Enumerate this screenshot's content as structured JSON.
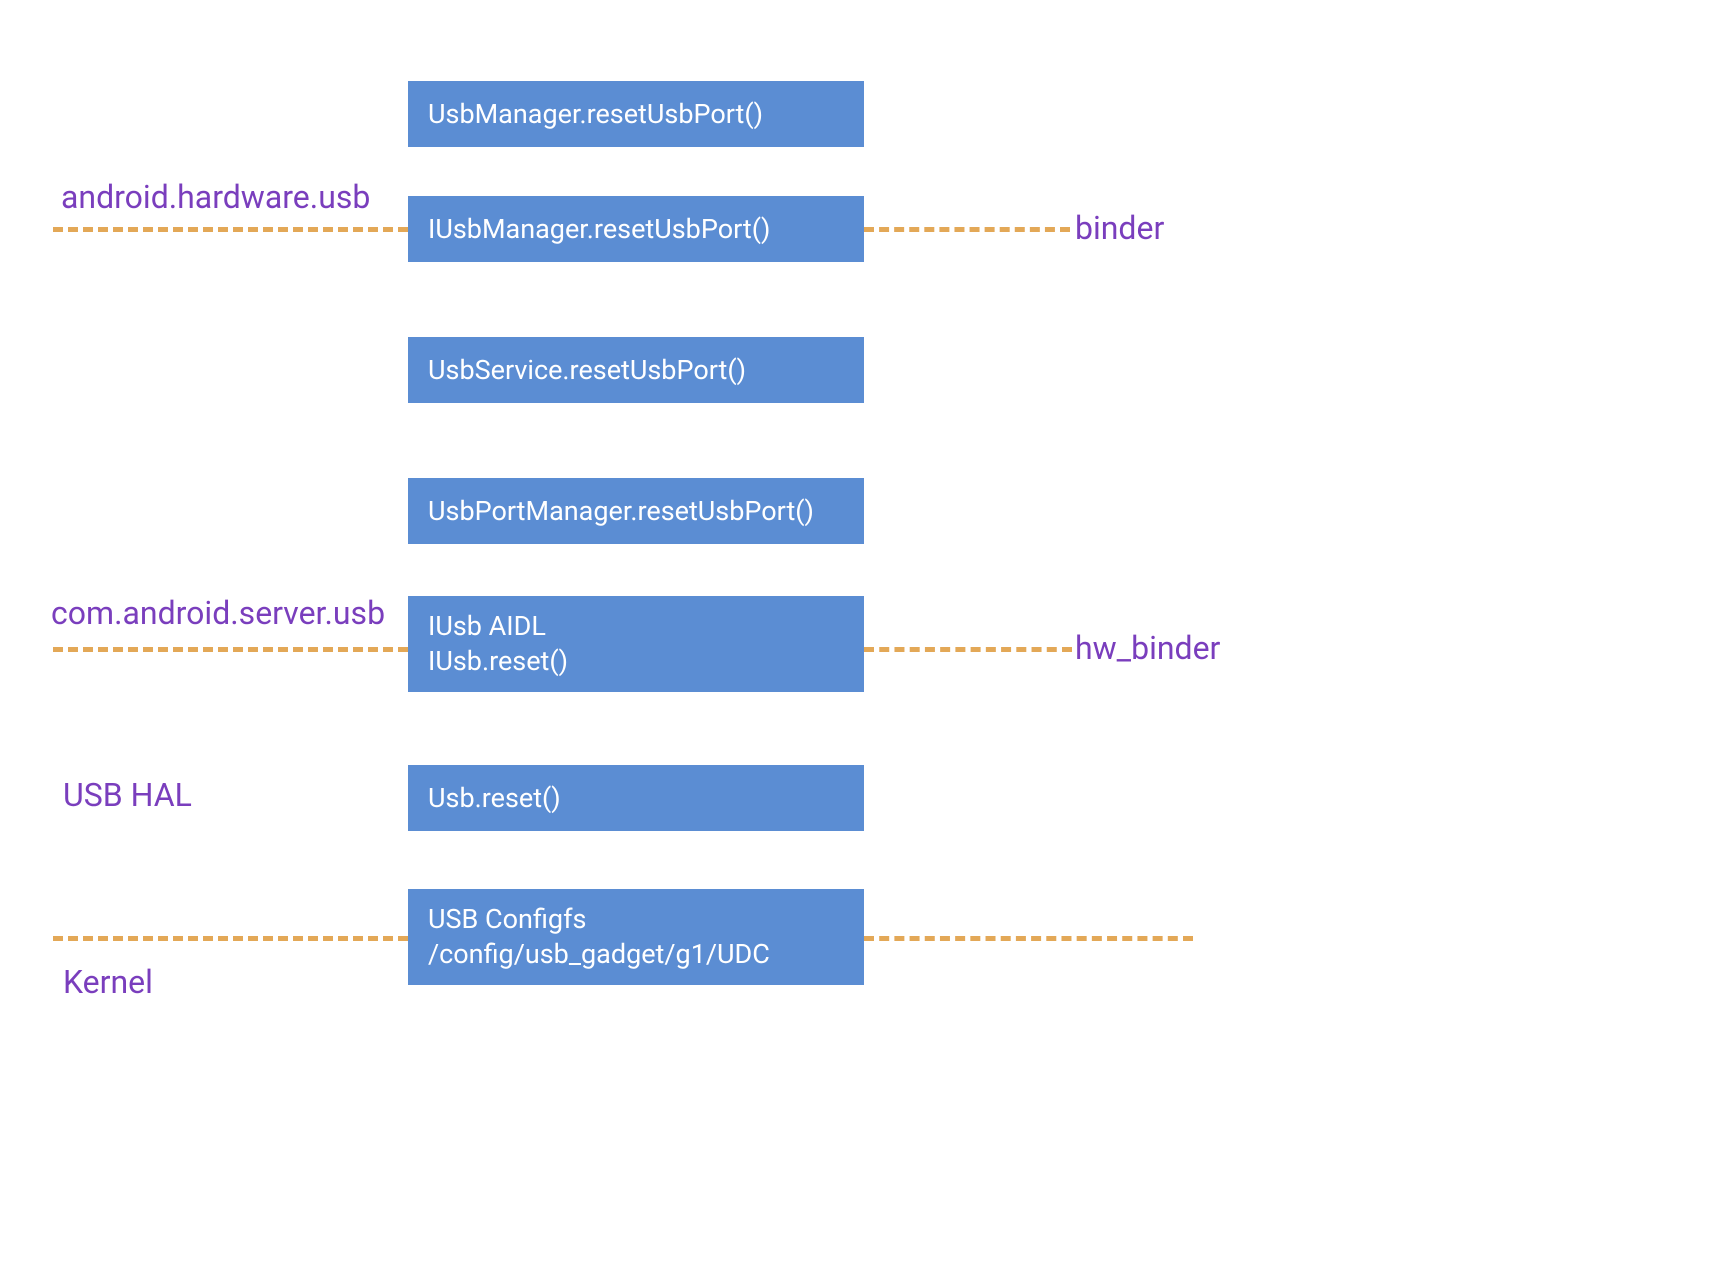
{
  "boxes": {
    "usbmanager": "UsbManager.resetUsbPort()",
    "iusbmanager": "IUsbManager.resetUsbPort()",
    "usbservice": "UsbService.resetUsbPort()",
    "usbportmanager": "UsbPortManager.resetUsbPort()",
    "iusb_aidl_line1": "IUsb AIDL",
    "iusb_aidl_line2": "IUsb.reset()",
    "usbreset": "Usb.reset()",
    "configfs_line1": "USB Configfs",
    "configfs_line2": "/config/usb_gadget/g1/UDC"
  },
  "labels": {
    "android_hardware_usb": "android.hardware.usb",
    "binder": "binder",
    "com_android_server_usb": "com.android.server.usb",
    "hw_binder": "hw_binder",
    "usb_hal": "USB HAL",
    "kernel": "Kernel"
  },
  "colors": {
    "box_bg": "#5b8dd3",
    "dash": "#e3a857",
    "label": "#7a3ebd"
  }
}
